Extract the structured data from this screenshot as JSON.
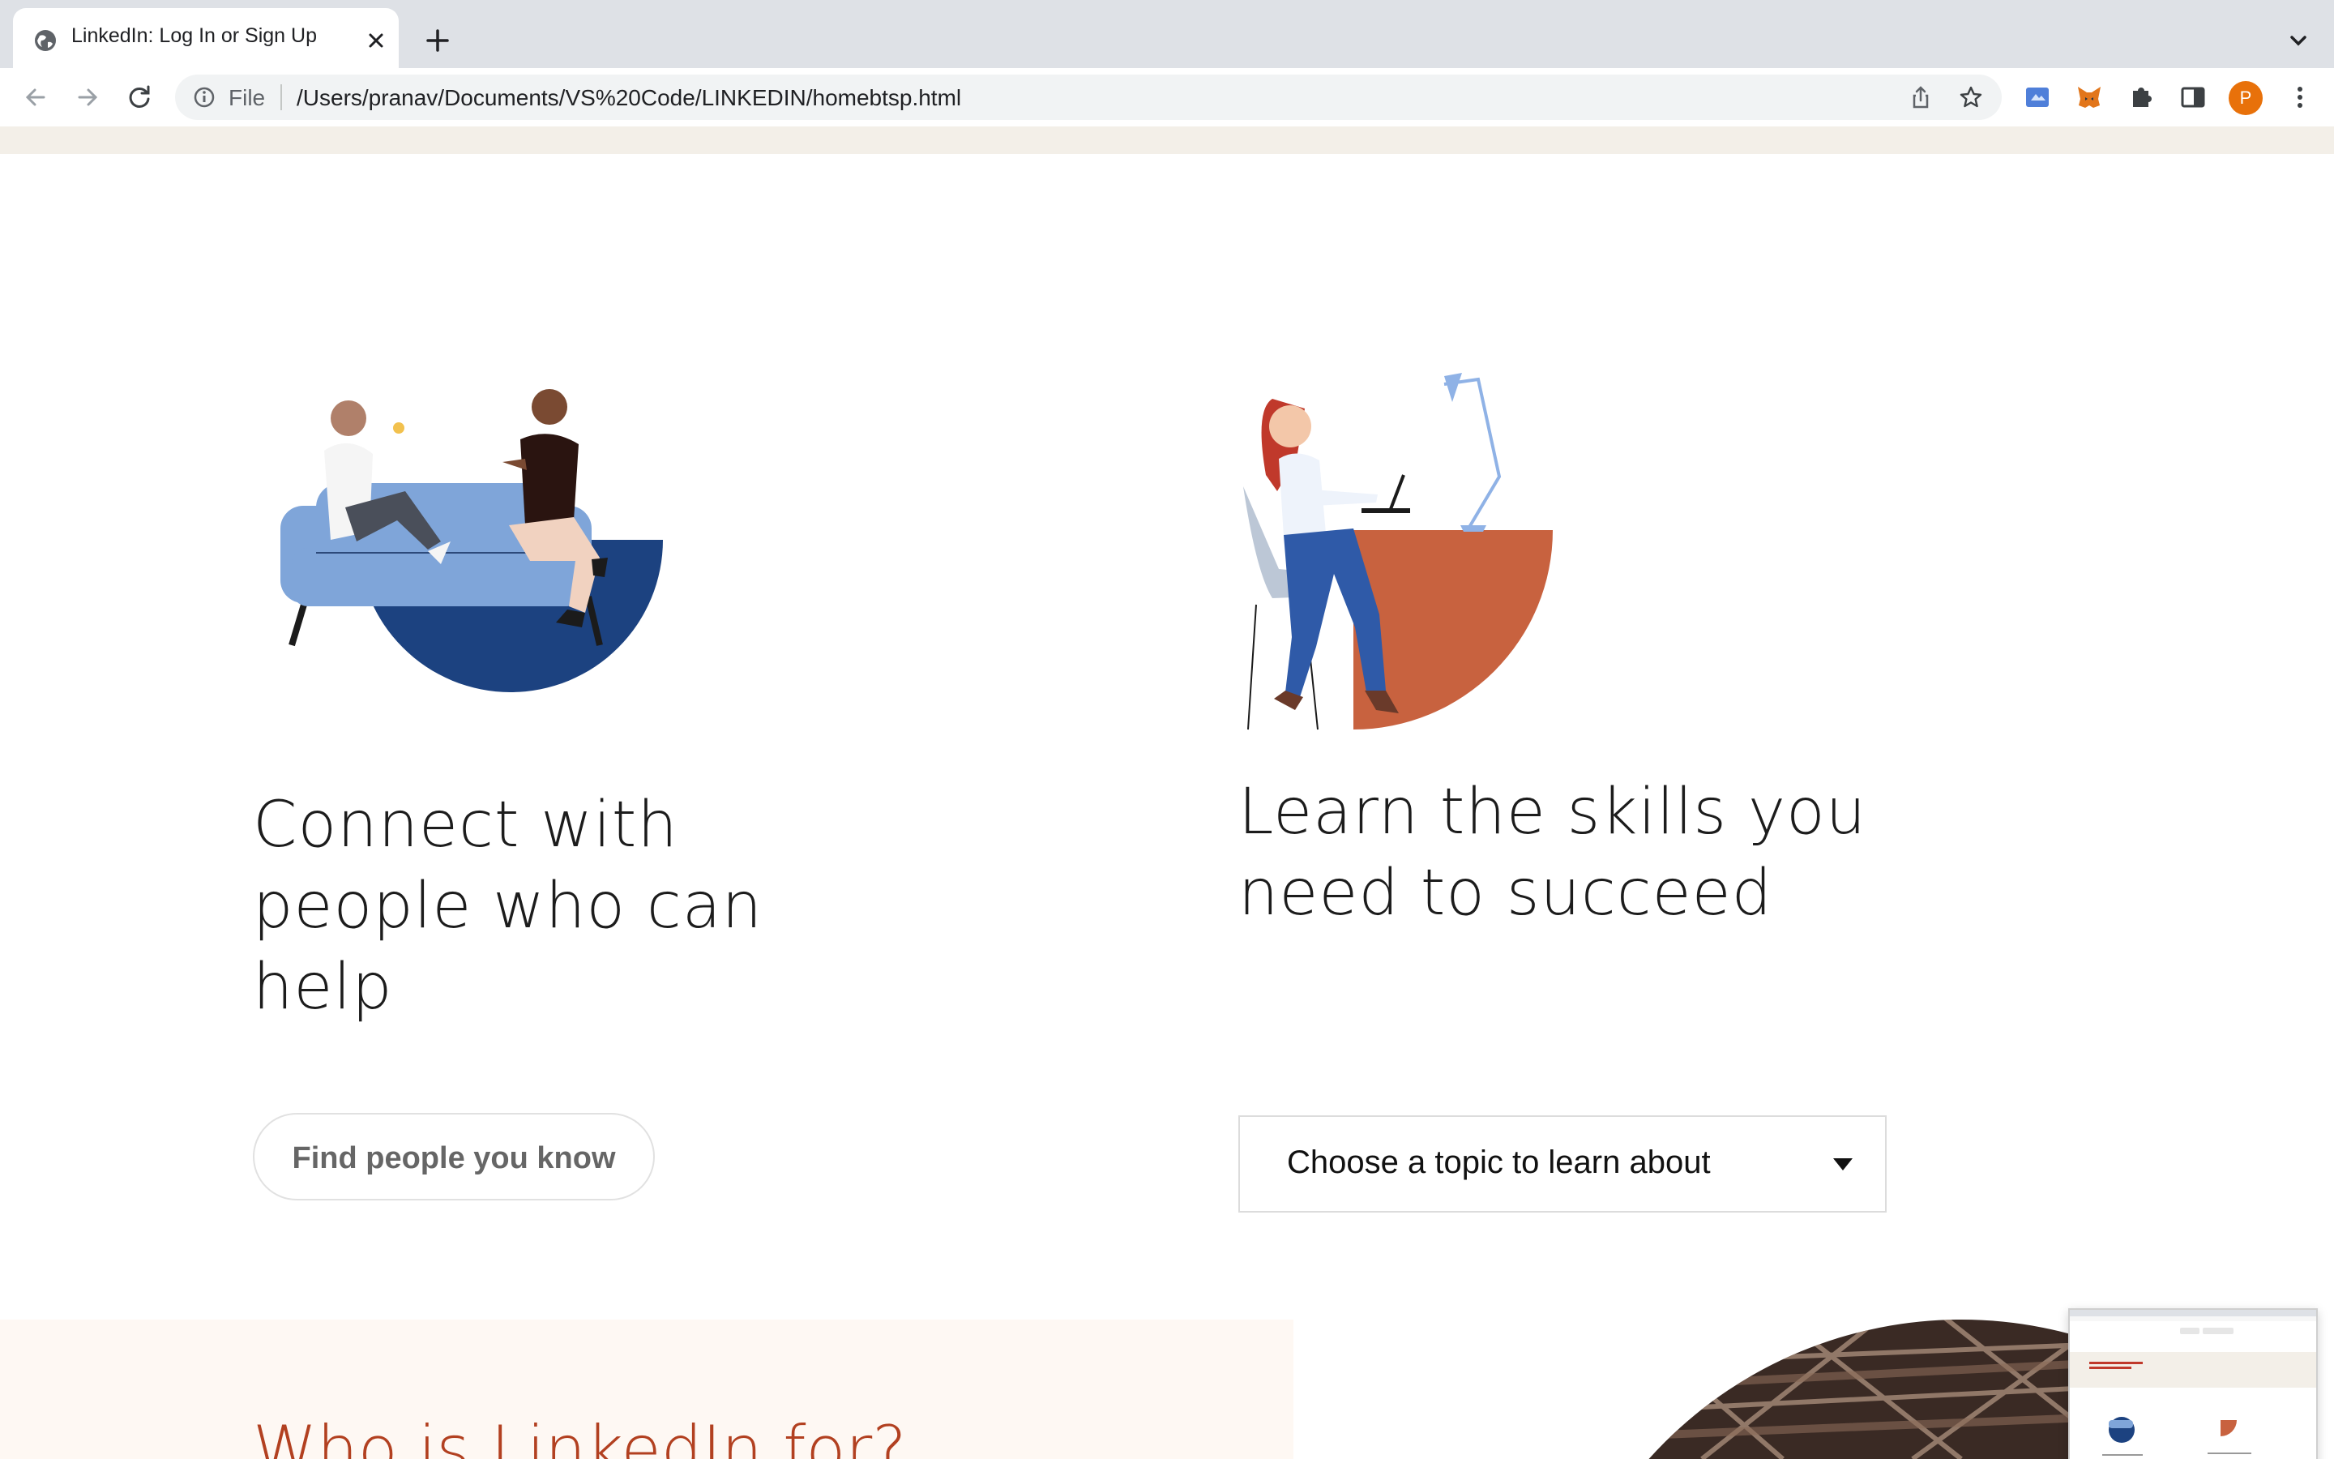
{
  "browser": {
    "tab_title": "LinkedIn: Log In or Sign Up",
    "url_scheme_label": "File",
    "url": "/Users/pranav/Documents/VS%20Code/LINKEDIN/homebtsp.html",
    "profile_initial": "P",
    "icons": [
      "globe-icon",
      "close-icon",
      "plus-icon",
      "chevron-down-icon",
      "back-icon",
      "forward-icon",
      "reload-icon",
      "info-icon",
      "share-icon",
      "star-icon",
      "extension-icon",
      "metamask-fox-icon",
      "puzzle-icon",
      "side-panel-icon",
      "kebab-menu-icon"
    ]
  },
  "sections": {
    "connect": {
      "heading_line1": "Connect with",
      "heading_line2": "people who can",
      "heading_line3": "help",
      "button_label": "Find people you know"
    },
    "learn": {
      "heading_line1": "Learn the skills you",
      "heading_line2": "need to succeed",
      "select_value": "Choose a topic to learn about"
    },
    "who": {
      "heading": "Who is LinkedIn for?"
    }
  },
  "colors": {
    "accent_blue": "#1c4280",
    "sofa_blue": "#7fa5d9",
    "desk_orange": "#c8623f",
    "heading_red": "#b24020",
    "cream": "#fef8f3",
    "beige": "#f3efe8"
  }
}
